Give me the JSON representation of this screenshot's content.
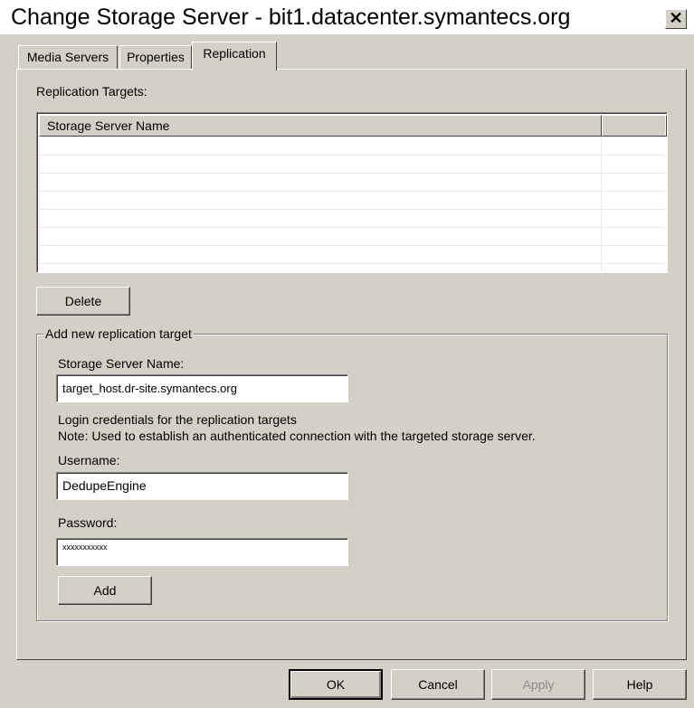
{
  "window": {
    "title": "Change Storage Server - bit1.datacenter.symantecs.org",
    "close_glyph": "✕"
  },
  "tabs": [
    {
      "label": "Media Servers",
      "active": false
    },
    {
      "label": "Properties",
      "active": false
    },
    {
      "label": "Replication",
      "active": true
    }
  ],
  "replication": {
    "targets_label": "Replication Targets:",
    "table": {
      "columns": [
        "Storage Server Name",
        ""
      ],
      "rows": [
        [],
        [],
        [],
        [],
        [],
        [],
        [],
        []
      ]
    },
    "delete_label": "Delete"
  },
  "add_target": {
    "group_title": "Add new replication target",
    "server_name_label": "Storage Server Name:",
    "server_name_value": "target_host.dr-site.symantecs.org",
    "credentials_text": "Login credentials for the replication targets",
    "note_text": "Note: Used to establish an authenticated connection with the targeted storage server.",
    "username_label": "Username:",
    "username_value": "DedupeEngine",
    "password_label": "Password:",
    "password_value": "xxxxxxxxxxx",
    "add_label": "Add"
  },
  "footer": {
    "ok_label": "OK",
    "cancel_label": "Cancel",
    "apply_label": "Apply",
    "help_label": "Help"
  }
}
